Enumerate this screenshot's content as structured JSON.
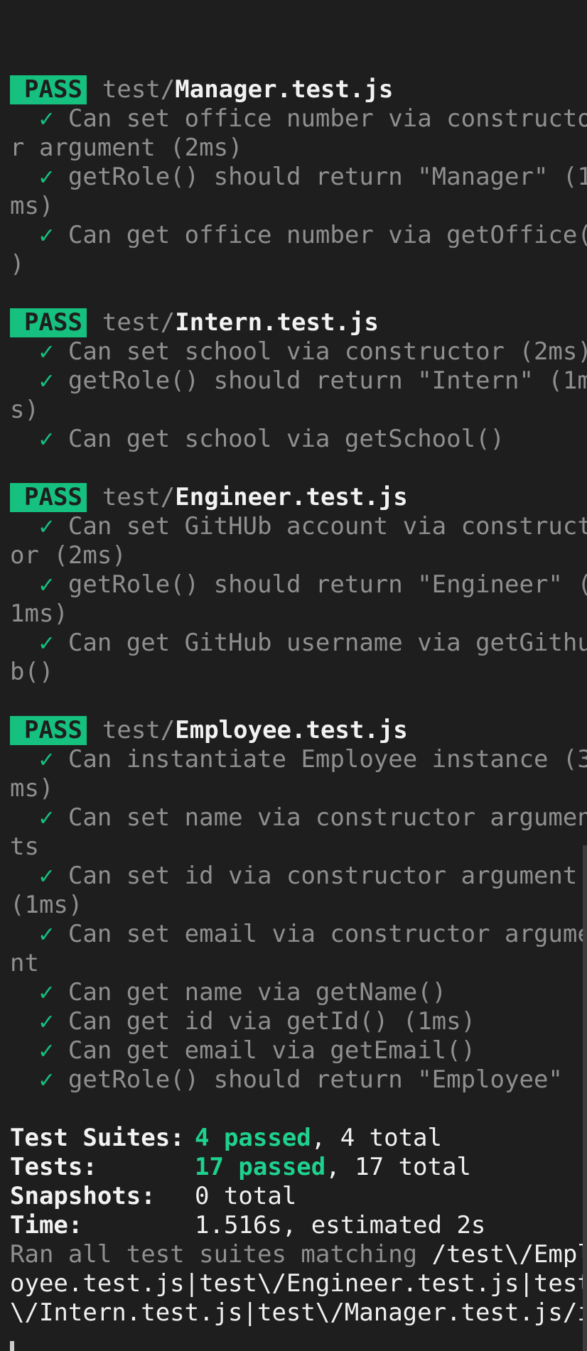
{
  "suites": [
    {
      "status": "PASS",
      "dir": "test/",
      "file": "Manager.test.js",
      "lines": [
        {
          "check": true,
          "text": "Can set office number via constructo"
        },
        {
          "check": false,
          "text": "r argument (2ms)"
        },
        {
          "check": true,
          "text": "getRole() should return \"Manager\" (1"
        },
        {
          "check": false,
          "text": "ms)"
        },
        {
          "check": true,
          "text": "Can get office number via getOffice("
        },
        {
          "check": false,
          "text": ")"
        }
      ]
    },
    {
      "status": "PASS",
      "dir": "test/",
      "file": "Intern.test.js",
      "lines": [
        {
          "check": true,
          "text": "Can set school via constructor (2ms)"
        },
        {
          "check": true,
          "text": "getRole() should return \"Intern\" (1m"
        },
        {
          "check": false,
          "text": "s)"
        },
        {
          "check": true,
          "text": "Can get school via getSchool()"
        }
      ]
    },
    {
      "status": "PASS",
      "dir": "test/",
      "file": "Engineer.test.js",
      "lines": [
        {
          "check": true,
          "text": "Can set GitHUb account via construct"
        },
        {
          "check": false,
          "text": "or (2ms)"
        },
        {
          "check": true,
          "text": "getRole() should return \"Engineer\" ("
        },
        {
          "check": false,
          "text": "1ms)"
        },
        {
          "check": true,
          "text": "Can get GitHub username via getGithu"
        },
        {
          "check": false,
          "text": "b()"
        }
      ]
    },
    {
      "status": "PASS",
      "dir": "test/",
      "file": "Employee.test.js",
      "lines": [
        {
          "check": true,
          "text": "Can instantiate Employee instance (3"
        },
        {
          "check": false,
          "text": "ms)"
        },
        {
          "check": true,
          "text": "Can set name via constructor argumen"
        },
        {
          "check": false,
          "text": "ts"
        },
        {
          "check": true,
          "text": "Can set id via constructor argument"
        },
        {
          "check": false,
          "text": "(1ms)"
        },
        {
          "check": true,
          "text": "Can set email via constructor argume"
        },
        {
          "check": false,
          "text": "nt"
        },
        {
          "check": true,
          "text": "Can get name via getName()"
        },
        {
          "check": true,
          "text": "Can get id via getId() (1ms)"
        },
        {
          "check": true,
          "text": "Can get email via getEmail()"
        },
        {
          "check": true,
          "text": "getRole() should return \"Employee\""
        }
      ]
    }
  ],
  "check_glyph": "✓",
  "summary": {
    "suites_label": "Test Suites:",
    "suites_passed": "4 passed",
    "suites_total": ", 4 total",
    "tests_label": "Tests:",
    "tests_passed": "17 passed",
    "tests_total": ", 17 total",
    "snapshots_label": "Snapshots:",
    "snapshots_value": "0 total",
    "time_label": "Time:",
    "time_value": "1.516s, estimated 2s"
  },
  "ran": {
    "prefix": "Ran all test suites matching ",
    "line1_pattern": "/test\\/Empl",
    "line2": "oyee.test.js|test\\/Engineer.test.js|test",
    "line3": "\\/Intern.test.js|test\\/Manager.test.js/i"
  },
  "colors": {
    "background": "#1e1e1e",
    "pass_badge": "#16c07f",
    "check": "#16c07f",
    "dim_text": "#8f8f8f",
    "bright_text": "#f2f2f2"
  }
}
